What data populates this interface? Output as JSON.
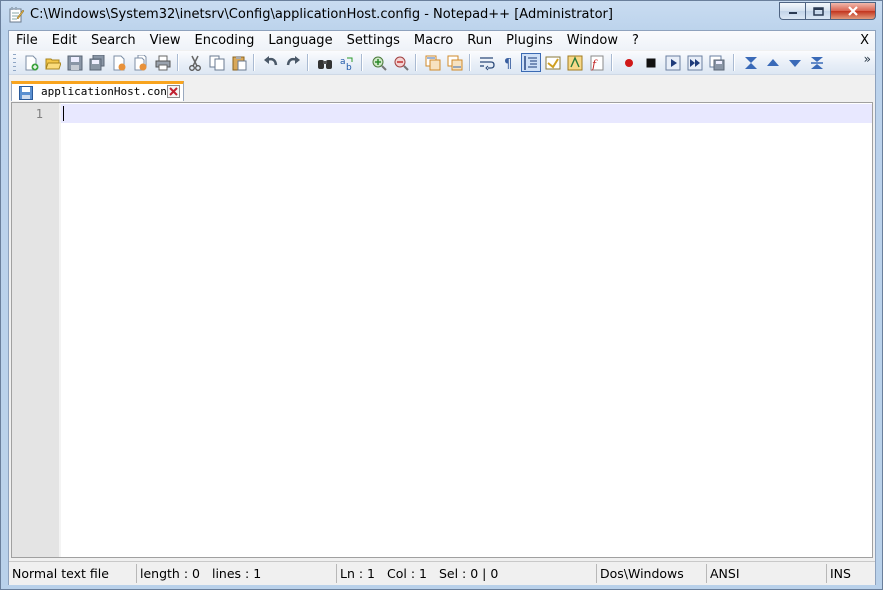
{
  "window": {
    "title": "C:\\Windows\\System32\\inetsrv\\Config\\applicationHost.config - Notepad++ [Administrator]"
  },
  "menubar": {
    "items": [
      "File",
      "Edit",
      "Search",
      "View",
      "Encoding",
      "Language",
      "Settings",
      "Macro",
      "Run",
      "Plugins",
      "Window",
      "?"
    ],
    "close_label": "X"
  },
  "toolbar": {
    "buttons": [
      "new-file-icon",
      "open-file-icon",
      "save-icon",
      "save-all-icon",
      "close-icon",
      "close-all-icon",
      "print-icon",
      "cut-icon",
      "copy-icon",
      "paste-icon",
      "undo-icon",
      "redo-icon",
      "find-icon",
      "replace-icon",
      "zoom-in-icon",
      "zoom-out-icon",
      "sync-vertical-icon",
      "sync-horizontal-icon",
      "word-wrap-icon",
      "show-all-chars-icon",
      "indent-guide-icon",
      "user-lang-icon",
      "doc-map-icon",
      "function-list-icon",
      "folder-workspace-icon",
      "record-macro-icon",
      "stop-record-icon",
      "play-macro-icon",
      "run-macro-multiple-icon",
      "save-macro-icon",
      "fold-all-icon",
      "prev-bookmark-icon",
      "next-bookmark-icon",
      "unfold-all-icon"
    ],
    "overflow_label": "»"
  },
  "tabs": [
    {
      "label": "applicationHost.config",
      "active": true
    }
  ],
  "editor": {
    "line_numbers": [
      "1"
    ],
    "content": ""
  },
  "statusbar": {
    "file_type": "Normal text file",
    "length": "length : 0",
    "lines": "lines : 1",
    "ln": "Ln : 1",
    "col": "Col : 1",
    "sel": "Sel : 0 | 0",
    "eol": "Dos\\Windows",
    "encoding": "ANSI",
    "mode": "INS"
  },
  "colors": {
    "accent": "#f8a41e",
    "current_line": "#e8e8ff",
    "gutter": "#e4e4e4"
  }
}
